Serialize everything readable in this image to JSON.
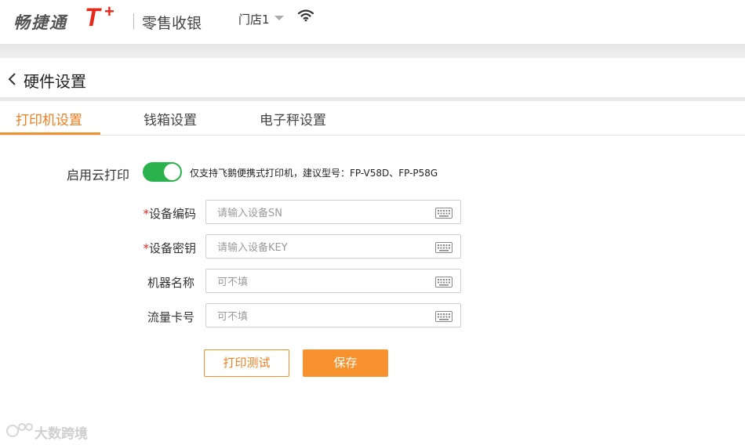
{
  "topbar": {
    "logo_text": "畅捷通",
    "logo_t": "T",
    "logo_plus": "+",
    "app_name": "零售收银",
    "store": "门店1"
  },
  "page": {
    "title": "硬件设置"
  },
  "tabs": [
    {
      "label": "打印机设置",
      "active": true
    },
    {
      "label": "钱箱设置",
      "active": false
    },
    {
      "label": "电子秤设置",
      "active": false
    }
  ],
  "cloud_print": {
    "label": "启用云打印",
    "enabled": true,
    "hint": "仅支持飞鹅便携式打印机，建议型号：FP-V58D、FP-P58G"
  },
  "form": {
    "required_mark": "*",
    "fields": [
      {
        "label": "设备编码",
        "required": true,
        "placeholder": "请输入设备SN",
        "value": ""
      },
      {
        "label": "设备密钥",
        "required": true,
        "placeholder": "请输入设备KEY",
        "value": ""
      },
      {
        "label": "机器名称",
        "required": false,
        "placeholder": "可不填",
        "value": ""
      },
      {
        "label": "流量卡号",
        "required": false,
        "placeholder": "可不填",
        "value": ""
      }
    ]
  },
  "actions": {
    "test_label": "打印测试",
    "save_label": "保存"
  },
  "watermark": {
    "text": "大数跨境"
  },
  "colors": {
    "accent": "#f07d1e",
    "toggle_on": "#2bb24c",
    "logo_red": "#e8291c"
  }
}
